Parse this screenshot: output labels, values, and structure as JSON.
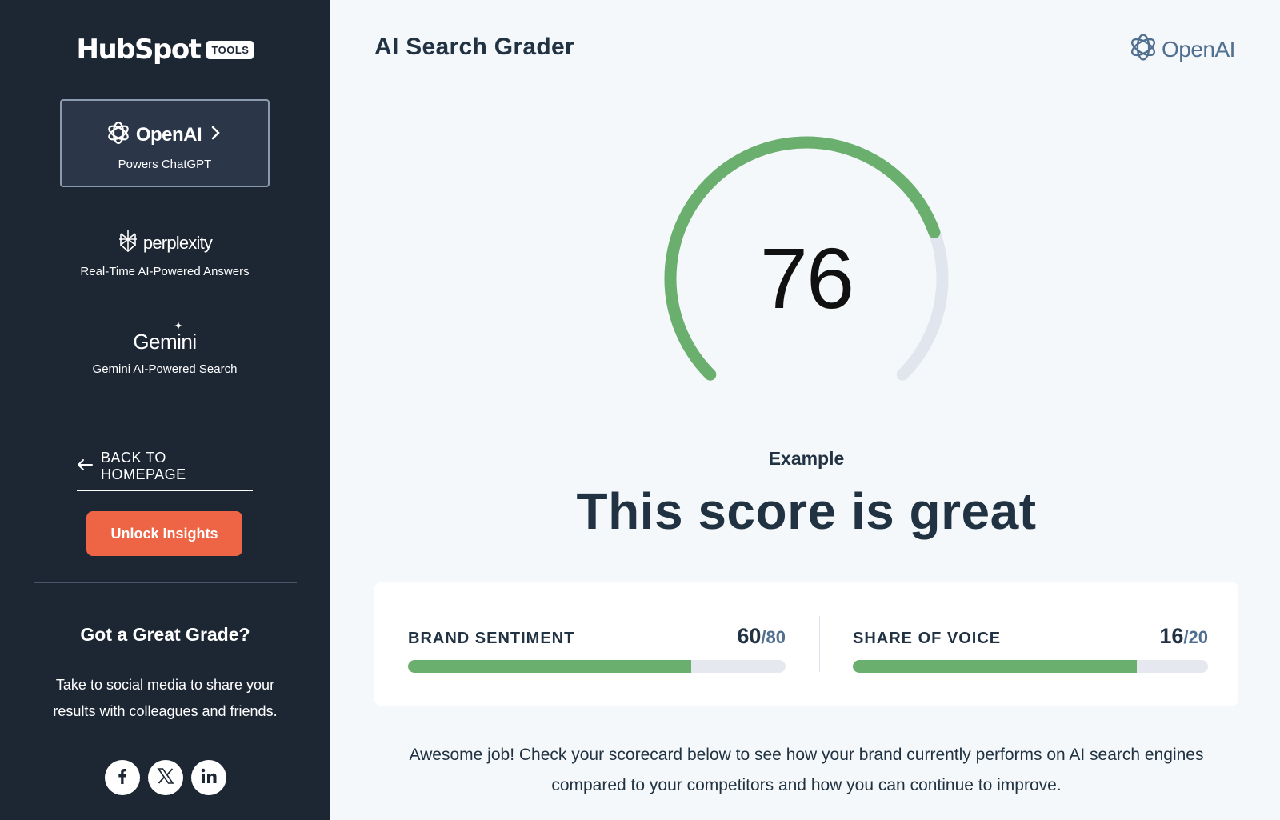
{
  "sidebar": {
    "brand": {
      "name": "HubSpot",
      "badge": "TOOLS"
    },
    "engines": [
      {
        "name": "OpenAI",
        "subtitle": "Powers ChatGPT",
        "icon": "openai-logo-icon",
        "active": true
      },
      {
        "name": "perplexity",
        "subtitle": "Real-Time AI-Powered Answers",
        "icon": "perplexity-logo-icon",
        "active": false
      },
      {
        "name": "Gemini",
        "subtitle": "Gemini AI-Powered Search",
        "icon": "gemini-sparkle-icon",
        "active": false
      }
    ],
    "back_label": "BACK TO HOMEPAGE",
    "unlock_label": "Unlock Insights",
    "share": {
      "title": "Got a Great Grade?",
      "body": "Take to social media to share your results with colleagues and friends."
    },
    "socials": [
      "facebook-icon",
      "x-icon",
      "linkedin-icon"
    ]
  },
  "main": {
    "title": "AI Search Grader",
    "corner_logo": "OpenAI",
    "score": "76",
    "score_fraction": 0.76,
    "example_label": "Example",
    "headline": "This score is great",
    "metrics": [
      {
        "label": "BRAND SENTIMENT",
        "score": "60",
        "max": "/80",
        "fraction": 0.75
      },
      {
        "label": "SHARE OF VOICE",
        "score": "16",
        "max": "/20",
        "fraction": 0.8
      }
    ],
    "summary": "Awesome job! Check your scorecard below to see how your brand currently performs on AI search engines compared to your competitors and how you can continue to improve."
  },
  "colors": {
    "sidebar_bg": "#1d2633",
    "accent_orange": "#ee6545",
    "success_green": "#6aaf6e",
    "track_gray": "#e5e9ef",
    "text_dark": "#213343"
  }
}
